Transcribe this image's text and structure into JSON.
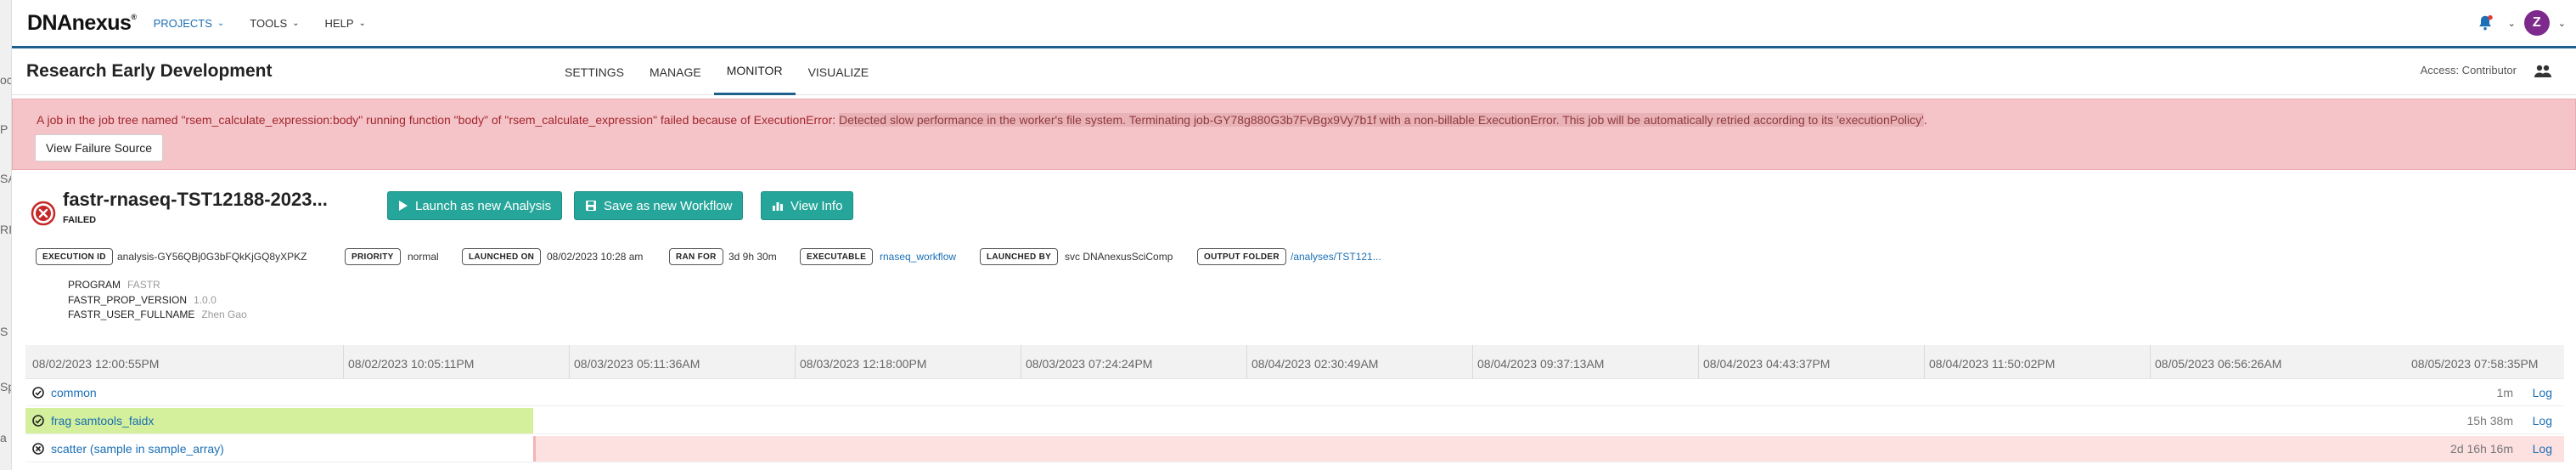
{
  "left_strip_fragments": [
    "oc",
    "P",
    "SA",
    "RI",
    "S",
    "Sp",
    "a"
  ],
  "nav": {
    "logo": "DNAnexus",
    "items": [
      {
        "label": "PROJECTS",
        "active": true
      },
      {
        "label": "TOOLS",
        "active": false
      },
      {
        "label": "HELP",
        "active": false
      }
    ],
    "avatar_letter": "Z"
  },
  "project": {
    "title": "Research Early Development",
    "tabs": [
      "SETTINGS",
      "MANAGE",
      "MONITOR",
      "VISUALIZE"
    ],
    "active_tab": "MONITOR",
    "access": "Access: Contributor"
  },
  "alert": {
    "text_before": "A job in the job tree named \"rsem_calculate_expression:body\" running function \"body\" of \"rsem_calculate_expression\" failed because of ExecutionError: ",
    "text_highlight": "Detected slow performance in the worker's file system. Terminating job-GY78g880G3b7FvBgx9Vy7b1f with a non-billable ExecutionError. This job will be automatically retried according to its 'executionPolicy'",
    "text_after": ".",
    "button": "View Failure Source"
  },
  "job": {
    "name": "fastr-rnaseq-TST12188-2023...",
    "status": "FAILED",
    "buttons": [
      "Launch as new Analysis",
      "Save as new Workflow",
      "View Info"
    ]
  },
  "meta": {
    "execution_id_label": "EXECUTION ID",
    "execution_id": "analysis-GY56QBj0G3bFQkKjGQ8yXPKZ",
    "priority_label": "PRIORITY",
    "priority": "normal",
    "launched_on_label": "LAUNCHED ON",
    "launched_on": "08/02/2023 10:28 am",
    "ran_for_label": "RAN FOR",
    "ran_for": "3d 9h 30m",
    "executable_label": "EXECUTABLE",
    "executable": "rnaseq_workflow",
    "launched_by_label": "LAUNCHED BY",
    "launched_by": "svc DNAnexusSciComp",
    "output_folder_label": "OUTPUT FOLDER",
    "output_folder": "/analyses/TST121..."
  },
  "properties": [
    {
      "key": "PROGRAM",
      "value": "FASTR"
    },
    {
      "key": "FASTR_PROP_VERSION",
      "value": "1.0.0"
    },
    {
      "key": "FASTR_USER_FULLNAME",
      "value": "Zhen Gao"
    }
  ],
  "timeline": {
    "ticks": [
      "08/02/2023 12:00:55PM",
      "08/02/2023 10:05:11PM",
      "08/03/2023 05:11:36AM",
      "08/03/2023 12:18:00PM",
      "08/03/2023 07:24:24PM",
      "08/04/2023 02:30:49AM",
      "08/04/2023 09:37:13AM",
      "08/04/2023 04:43:37PM",
      "08/04/2023 11:50:02PM",
      "08/05/2023 06:56:26AM",
      "08/05/2023 07:58:35PM"
    ],
    "rows": [
      {
        "name": "common",
        "duration": "1m",
        "log": "Log",
        "state": "done",
        "bar_start": 0.0,
        "bar_end": 0.0
      },
      {
        "name": "frag samtools_faidx",
        "duration": "15h 38m",
        "log": "Log",
        "state": "done",
        "bar_start": 0.0,
        "bar_end": 0.2
      },
      {
        "name": "scatter (sample in sample_array)",
        "duration": "2d 16h 16m",
        "log": "Log",
        "state": "failed",
        "bar_start": 0.2,
        "bar_end": 1.0
      }
    ]
  },
  "colors": {
    "accent": "#1f5f8b",
    "link": "#1a6fb5",
    "teal_button": "#26a69a",
    "alert_bg": "#f5c4c8",
    "alert_text": "#a3262e",
    "bar_done": "#d4f09c",
    "bar_failed": "#fde0e0",
    "failed_icon": "#c62828"
  }
}
